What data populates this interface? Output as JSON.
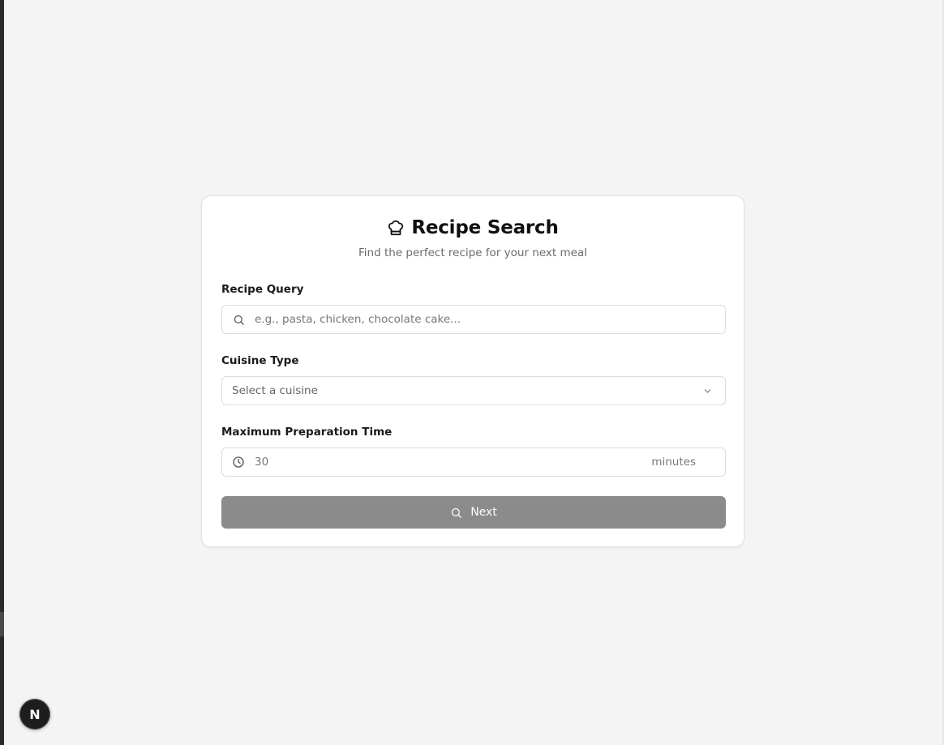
{
  "header": {
    "title": "Recipe Search",
    "subtitle": "Find the perfect recipe for your next meal",
    "icon": "chef-hat-icon"
  },
  "form": {
    "query": {
      "label": "Recipe Query",
      "placeholder": "e.g., pasta, chicken, chocolate cake...",
      "value": "",
      "icon": "search-icon"
    },
    "cuisine": {
      "label": "Cuisine Type",
      "selected": "Select a cuisine",
      "icon": "chevron-down-icon"
    },
    "prep_time": {
      "label": "Maximum Preparation Time",
      "placeholder": "30",
      "value": "",
      "unit": "minutes",
      "icon": "clock-icon"
    },
    "submit": {
      "label": "Next",
      "icon": "search-icon",
      "color": "#8b8b8c"
    }
  },
  "dev_indicator": {
    "letter": "N"
  }
}
